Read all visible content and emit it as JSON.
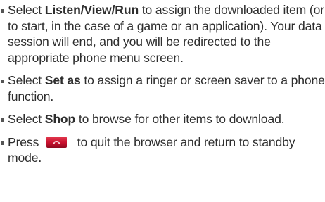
{
  "instructions": [
    {
      "prefix": "Select ",
      "keyword": "Listen/View/Run",
      "suffix": " to assign the downloaded item (or to start, in the case of a game or an application). Your data session will end, and you will be redirected to the appropriate phone menu screen."
    },
    {
      "prefix": "Select ",
      "keyword": "Set as",
      "suffix": " to assign a ringer or screen saver to a phone function."
    },
    {
      "prefix": "Select ",
      "keyword": "Shop",
      "suffix": " to browse for other items to download."
    },
    {
      "prefix": "Press ",
      "key_icon": "end-key-icon",
      "suffix": " to quit the browser and return to standby mode."
    }
  ],
  "colors": {
    "text": "#2e2e2e",
    "bullet": "#555555",
    "key_red": "#c8102e"
  }
}
